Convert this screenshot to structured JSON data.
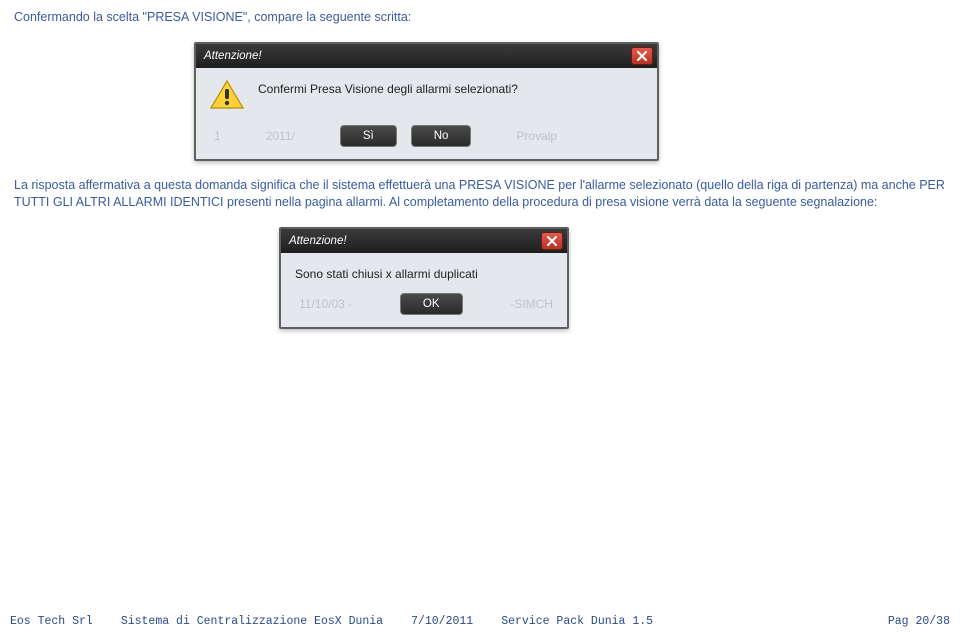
{
  "intro_text": "Confermando la scelta \"PRESA VISIONE\", compare la seguente scritta:",
  "dialog1": {
    "title": "Attenzione!",
    "message": "Confermi Presa Visione degli allarmi selezionati?",
    "btn_yes": "Sì",
    "btn_no": "No",
    "ghost_left": "1",
    "ghost_mid": "2011/",
    "ghost_right": "Provalp"
  },
  "para_text": "La risposta affermativa a questa domanda significa che il sistema effettuerà una PRESA VISIONE per l'allarme selezionato (quello della riga di partenza) ma anche PER TUTTI GLI ALTRI ALLARMI IDENTICI presenti nella pagina allarmi. Al completamento della procedura di presa visione verrà data la seguente segnalazione:",
  "dialog2": {
    "title": "Attenzione!",
    "message": "Sono stati chiusi x allarmi duplicati",
    "btn_ok": "OK",
    "ghost_left": "11/10/03 -",
    "ghost_right": "-SIMCH"
  },
  "footer": {
    "company": "Eos Tech Srl",
    "system": "Sistema di Centralizzazione EosX Dunia",
    "date": "7/10/2011",
    "pack": "Service Pack Dunia 1.5",
    "page": "Pag 20/38"
  }
}
